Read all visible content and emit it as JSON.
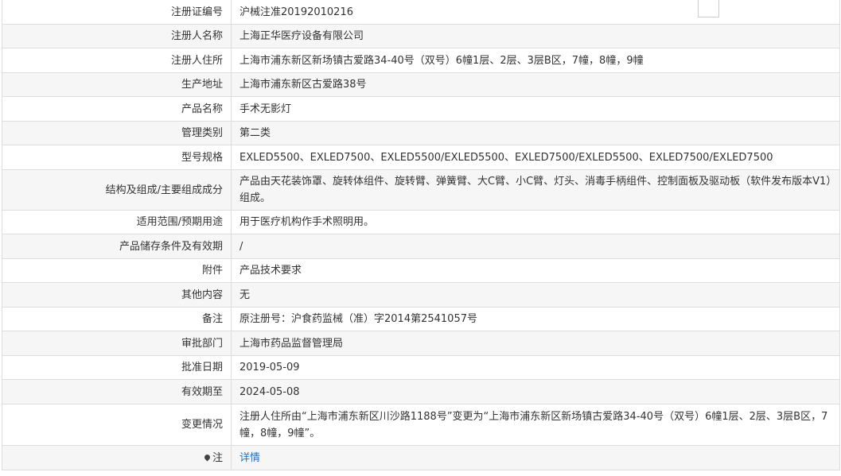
{
  "rows": [
    {
      "key": "注册证编号",
      "value": "沪械注准20192010216"
    },
    {
      "key": "注册人名称",
      "value": "上海正华医疗设备有限公司"
    },
    {
      "key": "注册人住所",
      "value": "上海市浦东新区新场镇古爱路34-40号（双号）6幢1层、2层、3层B区，7幢，8幢，9幢"
    },
    {
      "key": "生产地址",
      "value": "上海市浦东新区古爱路38号"
    },
    {
      "key": "产品名称",
      "value": "手术无影灯"
    },
    {
      "key": "管理类别",
      "value": "第二类"
    },
    {
      "key": "型号规格",
      "value": "EXLED5500、EXLED7500、EXLED5500/EXLED5500、EXLED7500/EXLED5500、EXLED7500/EXLED7500"
    },
    {
      "key": "结构及组成/主要组成成分",
      "value": "产品由天花装饰罩、旋转体组件、旋转臂、弹簧臂、大C臂、小C臂、灯头、消毒手柄组件、控制面板及驱动板（软件发布版本V1）组成。"
    },
    {
      "key": "适用范围/预期用途",
      "value": "用于医疗机构作手术照明用。"
    },
    {
      "key": "产品储存条件及有效期",
      "value": "/"
    },
    {
      "key": "附件",
      "value": "产品技术要求"
    },
    {
      "key": "其他内容",
      "value": "无"
    },
    {
      "key": "备注",
      "value": "原注册号：沪食药监械（准）字2014第2541057号"
    },
    {
      "key": "审批部门",
      "value": "上海市药品监督管理局"
    },
    {
      "key": "批准日期",
      "value": "2019-05-09"
    },
    {
      "key": "有效期至",
      "value": "2024-05-08"
    },
    {
      "key": "变更情况",
      "value": "注册人住所由“上海市浦东新区川沙路1188号”变更为“上海市浦东新区新场镇古爱路34-40号（双号）6幢1层、2层、3层B区，7幢，8幢，9幢”。"
    }
  ],
  "note": {
    "key": "注",
    "link": "详情",
    "icon": "pin-icon"
  }
}
